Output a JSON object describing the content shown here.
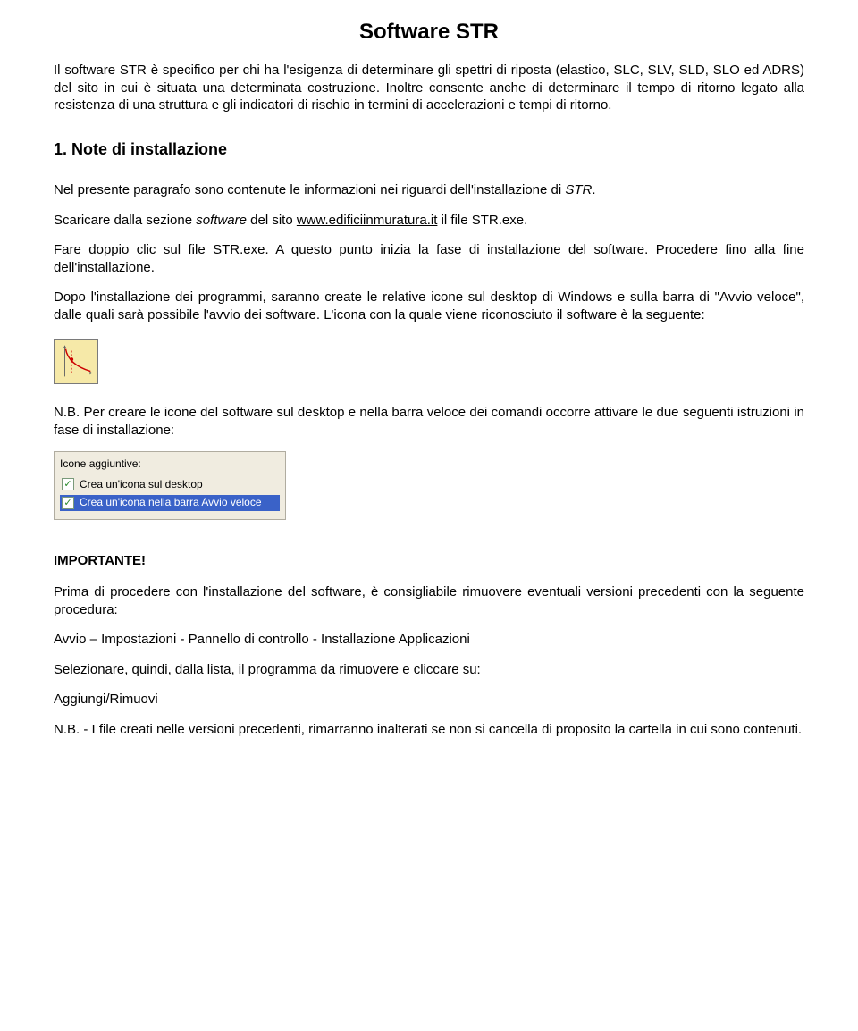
{
  "title": "Software STR",
  "intro": {
    "p1": "Il software STR è specifico per chi ha l'esigenza di determinare gli spettri di riposta (elastico, SLC, SLV, SLD, SLO ed ADRS) del sito in cui è situata una determinata costruzione. Inoltre consente anche di determinare il tempo di ritorno legato alla resistenza di una struttura e gli indicatori di rischio in termini di accelerazioni e tempi di ritorno."
  },
  "section1": {
    "heading": "1. Note di installazione",
    "p1_a": "Nel presente paragrafo sono contenute le informazioni nei riguardi dell'installazione di ",
    "p1_b": "STR",
    "p1_c": ".",
    "p2_a": "Scaricare dalla sezione ",
    "p2_b": "software",
    "p2_c": " del sito ",
    "p2_d": "www.edificiinmuratura.it",
    "p2_e": " il file STR.exe.",
    "p3": "Fare doppio clic sul file STR.exe. A questo punto inizia la fase di installazione del software. Procedere fino alla fine dell'installazione.",
    "p4": "Dopo l'installazione dei programmi, saranno create le relative icone sul desktop di Windows e sulla barra di \"Avvio veloce\", dalle quali sarà possibile l'avvio dei software. L'icona con la quale viene riconosciuto il software è la seguente:",
    "p5": "N.B. Per creare le icone del software sul desktop e nella barra veloce dei comandi occorre attivare le due seguenti istruzioni in fase di installazione:",
    "installer": {
      "label": "Icone aggiuntive:",
      "opt1": "Crea un'icona sul desktop",
      "opt2": "Crea un'icona nella barra Avvio veloce"
    },
    "important": "IMPORTANTE!",
    "p6": "Prima di procedere con l'installazione del software, è consigliabile rimuovere eventuali versioni precedenti con la seguente procedura:",
    "p7": "Avvio – Impostazioni - Pannello di controllo - Installazione Applicazioni",
    "p8": "Selezionare, quindi, dalla lista, il programma da rimuovere e cliccare su:",
    "p9": "Aggiungi/Rimuovi",
    "p10": "N.B. - I file creati nelle versioni precedenti, rimarranno inalterati se non si cancella di proposito la cartella in cui sono contenuti."
  }
}
